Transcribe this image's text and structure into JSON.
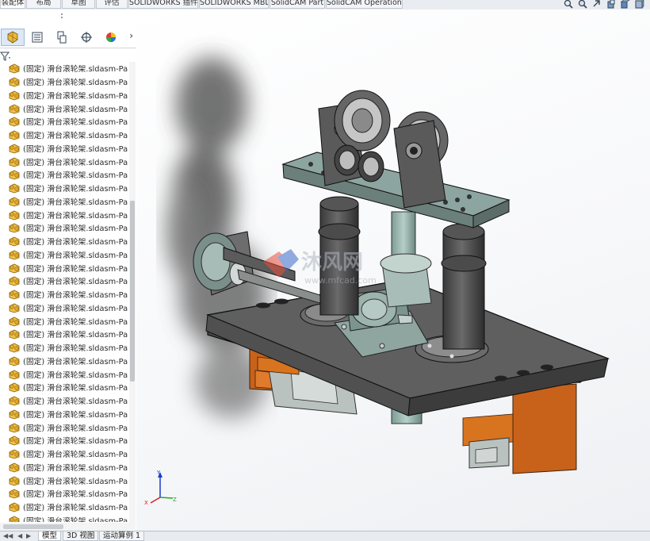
{
  "tabs": [
    "装配体",
    "布局",
    "草图",
    "评估",
    "SOLIDWORKS 插件",
    "SOLIDWORKS MBD",
    "SolidCAM Part",
    "SolidCAM Operations"
  ],
  "active_tab": "装配体",
  "feature_tree": {
    "items": [
      "(固定) 滑台滚轮架.sldasm-Part-",
      "(固定) 滑台滚轮架.sldasm-Part-",
      "(固定) 滑台滚轮架.sldasm-Part-",
      "(固定) 滑台滚轮架.sldasm-Part-",
      "(固定) 滑台滚轮架.sldasm-Part-",
      "(固定) 滑台滚轮架.sldasm-Part-",
      "(固定) 滑台滚轮架.sldasm-Part-",
      "(固定) 滑台滚轮架.sldasm-Part-",
      "(固定) 滑台滚轮架.sldasm-Part-",
      "(固定) 滑台滚轮架.sldasm-Part-",
      "(固定) 滑台滚轮架.sldasm-Part-",
      "(固定) 滑台滚轮架.sldasm-Part-",
      "(固定) 滑台滚轮架.sldasm-Part-",
      "(固定) 滑台滚轮架.sldasm-Part-",
      "(固定) 滑台滚轮架.sldasm-Part-",
      "(固定) 滑台滚轮架.sldasm-Part-",
      "(固定) 滑台滚轮架.sldasm-Part-",
      "(固定) 滑台滚轮架.sldasm-Part-",
      "(固定) 滑台滚轮架.sldasm-Part-",
      "(固定) 滑台滚轮架.sldasm-Part-",
      "(固定) 滑台滚轮架.sldasm-Part-",
      "(固定) 滑台滚轮架.sldasm-Part-",
      "(固定) 滑台滚轮架.sldasm-Part-",
      "(固定) 滑台滚轮架.sldasm-Part-",
      "(固定) 滑台滚轮架.sldasm-Part-",
      "(固定) 滑台滚轮架.sldasm-Part-",
      "(固定) 滑台滚轮架.sldasm-Part-",
      "(固定) 滑台滚轮架.sldasm-Part-",
      "(固定) 滑台滚轮架.sldasm-Part-",
      "(固定) 滑台滚轮架.sldasm-Part-",
      "(固定) 滑台滚轮架.sldasm-Part-",
      "(固定) 滑台滚轮架.sldasm-Part-",
      "(固定) 滑台滚轮架.sldasm-Part-",
      "(固定) 滑台滚轮架.sldasm-Part-",
      "(固定) 滑台滚轮架.sldasm-Part-"
    ]
  },
  "bottom_tabs": [
    "模型",
    "3D 视图",
    "运动算例 1"
  ],
  "active_bottom_tab": "模型",
  "watermark": {
    "brand": "沐风网",
    "url": "www.mfcad.com"
  },
  "colors": {
    "plate": "#5a5a5a",
    "block": "#c8621a",
    "shaft": "#8fb0a6",
    "accent": "#0a5bd3"
  }
}
